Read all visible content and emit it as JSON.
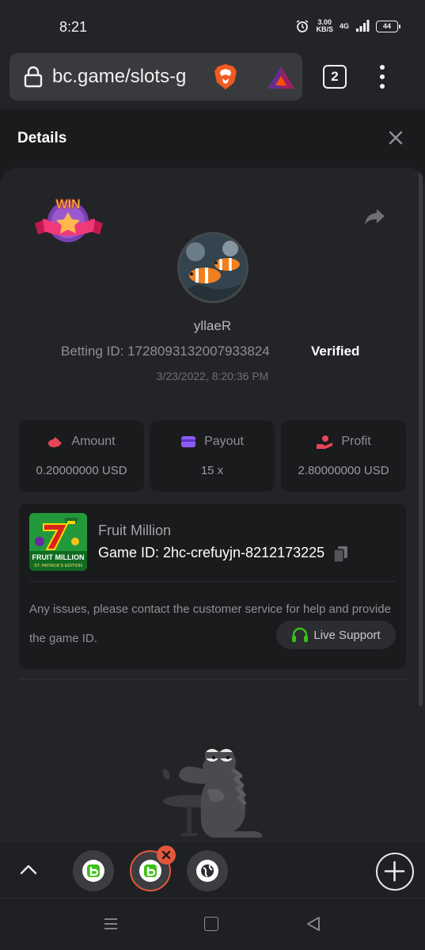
{
  "status_bar": {
    "time": "8:21",
    "net_speed_value": "3.00",
    "net_speed_unit": "KB/S",
    "net_type": "4G",
    "battery": "44"
  },
  "browser": {
    "url": "bc.game/slots-g",
    "tab_count": "2"
  },
  "header": {
    "title": "Details"
  },
  "bet": {
    "badge": "WIN",
    "username": "yllaeR",
    "betting_id_label": "Betting ID: 1728093132007933824",
    "verified": "Verified",
    "timestamp": "3/23/2022, 8:20:36 PM"
  },
  "stats": [
    {
      "label": "Amount",
      "value": "0.20000000 USD",
      "icon": "coins-icon",
      "color": "#e8455a"
    },
    {
      "label": "Payout",
      "value": "15 x",
      "icon": "wallet-icon",
      "color": "#8b5cf6"
    },
    {
      "label": "Profit",
      "value": "2.80000000 USD",
      "icon": "hand-coin-icon",
      "color": "#e8455a"
    }
  ],
  "game": {
    "name": "Fruit Million",
    "game_id": "Game ID: 2hc-crefuyjn-8212173225",
    "thumb_title": "FRUIT MILLION",
    "thumb_subtitle": "ST. PATRICK'S EDITION",
    "help_text": "Any issues, please contact the customer service for help and provide the game ID.",
    "support_label": "Live Support",
    "support_color": "#3bc117"
  }
}
